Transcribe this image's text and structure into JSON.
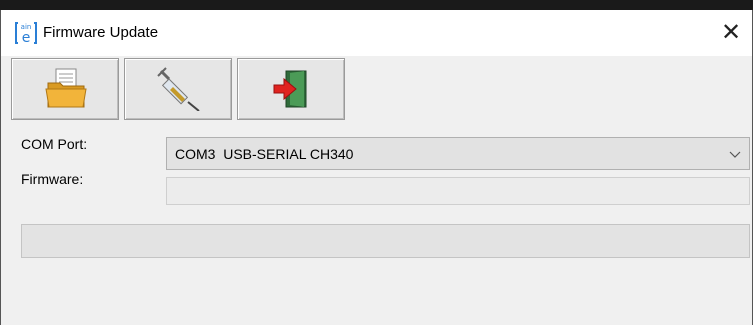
{
  "window": {
    "title": "Firmware Update",
    "icon": "rain-e-app-icon",
    "close_glyph": "✕"
  },
  "toolbar": {
    "buttons": [
      {
        "icon": "open-folder-icon"
      },
      {
        "icon": "syringe-flash-icon"
      },
      {
        "icon": "exit-door-icon"
      }
    ]
  },
  "form": {
    "com_port_label": "COM Port:",
    "com_port_value": "COM3  USB-SERIAL CH340",
    "firmware_label": "Firmware:",
    "firmware_value": ""
  },
  "progress": {
    "value": 0
  },
  "colors": {
    "window_bg": "#f0f0f0",
    "titlebar_bg": "#ffffff",
    "progress_fill": "#06b025"
  }
}
